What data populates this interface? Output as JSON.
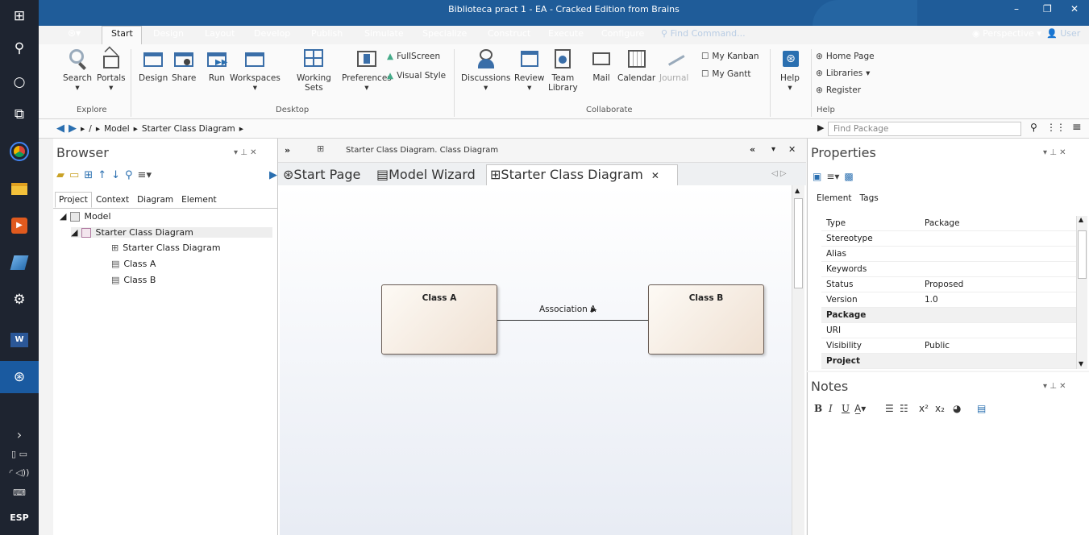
{
  "window": {
    "title": "Biblioteca pract 1 - EA - Cracked Edition from Brains",
    "find_command_placeholder": "Find Command...",
    "perspective": "Perspective",
    "user": "User"
  },
  "ribbon_tabs": [
    "Start",
    "Design",
    "Layout",
    "Develop",
    "Publish",
    "Simulate",
    "Specialize",
    "Construct",
    "Execute",
    "Configure"
  ],
  "ribbon": {
    "search": "Search",
    "portals": "Portals",
    "design": "Design",
    "share": "Share",
    "run": "Run",
    "workspaces": "Workspaces",
    "working_sets_1": "Working",
    "working_sets_2": "Sets",
    "preferences": "Preferences",
    "fullscreen": "FullScreen",
    "visual_style": "Visual Style",
    "discussions": "Discussions",
    "review": "Review",
    "team_library_1": "Team",
    "team_library_2": "Library",
    "mail": "Mail",
    "calendar": "Calendar",
    "journal": "Journal",
    "my_kanban": "My Kanban",
    "my_gantt": "My Gantt",
    "help": "Help",
    "home_page": "Home Page",
    "libraries": "Libraries",
    "register": "Register",
    "groups": {
      "explore": "Explore",
      "desktop": "Desktop",
      "collaborate": "Collaborate",
      "help": "Help"
    }
  },
  "breadcrumb": {
    "sep": "/",
    "model": "Model",
    "diagram": "Starter Class Diagram",
    "find_package": "Find Package"
  },
  "browser": {
    "title": "Browser",
    "tabs": [
      "Project",
      "Context",
      "Diagram",
      "Element"
    ],
    "tree": {
      "model": "Model",
      "package": "Starter Class Diagram",
      "diagram": "Starter Class Diagram",
      "class_a": "Class A",
      "class_b": "Class B"
    }
  },
  "diagram": {
    "header": "Starter Class Diagram.  Class Diagram",
    "tabs": [
      "Start Page",
      "Model Wizard",
      "Starter Class Diagram"
    ],
    "class_a": "Class A",
    "class_b": "Class B",
    "association": "Association A"
  },
  "properties": {
    "title": "Properties",
    "tabs": [
      "Element",
      "Tags"
    ],
    "rows": [
      {
        "k": "Type",
        "v": "Package"
      },
      {
        "k": "Stereotype",
        "v": ""
      },
      {
        "k": "Alias",
        "v": ""
      },
      {
        "k": "Keywords",
        "v": ""
      },
      {
        "k": "Status",
        "v": "Proposed"
      },
      {
        "k": "Version",
        "v": "1.0"
      },
      {
        "k": "Package",
        "v": ""
      },
      {
        "k": "URI",
        "v": ""
      },
      {
        "k": "Visibility",
        "v": "Public"
      },
      {
        "k": "Project",
        "v": ""
      }
    ]
  },
  "notes": {
    "title": "Notes"
  },
  "taskbar": {
    "language": "ESP"
  }
}
